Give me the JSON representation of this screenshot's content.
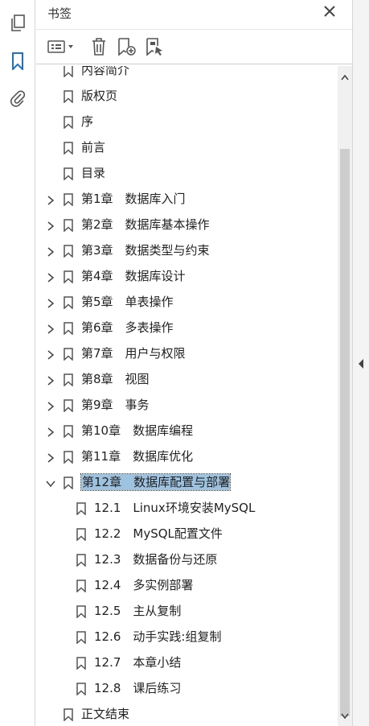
{
  "left_rail": {
    "items": [
      {
        "icon": "pages-icon"
      },
      {
        "icon": "bookmark-icon",
        "active": true
      },
      {
        "icon": "attachment-icon"
      }
    ]
  },
  "panel": {
    "title": "书签",
    "close_icon": "close-icon"
  },
  "toolbar": {
    "options_icon": "options-menu-icon",
    "delete_icon": "trash-icon",
    "new_bookmark_icon": "new-bookmark-icon",
    "bookmark_from_selection_icon": "bookmark-selection-icon"
  },
  "bookmarks": [
    {
      "label": "内容简介",
      "level": 0,
      "expand": "none",
      "partial": true
    },
    {
      "label": "版权页",
      "level": 0,
      "expand": "none"
    },
    {
      "label": "序",
      "level": 0,
      "expand": "none"
    },
    {
      "label": "前言",
      "level": 0,
      "expand": "none"
    },
    {
      "label": "目录",
      "level": 0,
      "expand": "none"
    },
    {
      "label": "第1章　数据库入门",
      "level": 0,
      "expand": "collapsed"
    },
    {
      "label": "第2章　数据库基本操作",
      "level": 0,
      "expand": "collapsed"
    },
    {
      "label": "第3章　数据类型与约束",
      "level": 0,
      "expand": "collapsed"
    },
    {
      "label": "第4章　数据库设计",
      "level": 0,
      "expand": "collapsed"
    },
    {
      "label": "第5章　单表操作",
      "level": 0,
      "expand": "collapsed"
    },
    {
      "label": "第6章　多表操作",
      "level": 0,
      "expand": "collapsed"
    },
    {
      "label": "第7章　用户与权限",
      "level": 0,
      "expand": "collapsed"
    },
    {
      "label": "第8章　视图",
      "level": 0,
      "expand": "collapsed"
    },
    {
      "label": "第9章　事务",
      "level": 0,
      "expand": "collapsed"
    },
    {
      "label": "第10章　数据库编程",
      "level": 0,
      "expand": "collapsed"
    },
    {
      "label": "第11章　数据库优化",
      "level": 0,
      "expand": "collapsed"
    },
    {
      "label": "第12章　数据库配置与部署",
      "level": 0,
      "expand": "expanded",
      "selected": true
    },
    {
      "label": "12.1　Linux环境安装MySQL",
      "level": 1,
      "expand": "none"
    },
    {
      "label": "12.2　MySQL配置文件",
      "level": 1,
      "expand": "none"
    },
    {
      "label": "12.3　数据备份与还原",
      "level": 1,
      "expand": "none"
    },
    {
      "label": "12.4　多实例部署",
      "level": 1,
      "expand": "none"
    },
    {
      "label": "12.5　主从复制",
      "level": 1,
      "expand": "none"
    },
    {
      "label": "12.6　动手实践:组复制",
      "level": 1,
      "expand": "none"
    },
    {
      "label": "12.7　本章小结",
      "level": 1,
      "expand": "none"
    },
    {
      "label": "12.8　课后练习",
      "level": 1,
      "expand": "none"
    },
    {
      "label": "正文结束",
      "level": 0,
      "expand": "none"
    }
  ],
  "scroll": {
    "position": 0.12,
    "visible_fraction": 0.86
  },
  "colors": {
    "selection": "#9ec3e1",
    "rail_active": "#1a73c9",
    "icon": "#555555"
  }
}
